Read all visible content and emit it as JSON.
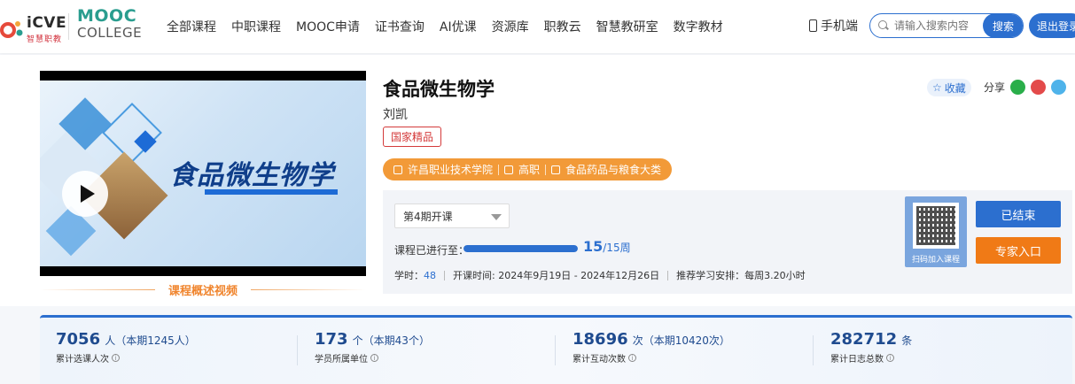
{
  "header": {
    "logo_icve": "iCVE",
    "logo_icve_sub": "智慧职教",
    "logo_mooc": "MOOC",
    "logo_mooc_sub": "COLLEGE",
    "nav": [
      "全部课程",
      "中职课程",
      "MOOC申请",
      "证书查询",
      "AI优课",
      "资源库",
      "职教云",
      "智慧教研室",
      "数字教材"
    ],
    "mobile_label": "手机端",
    "search_placeholder": "请输入搜索内容",
    "search_button": "搜索",
    "logout_button": "退出登录"
  },
  "course": {
    "title": "食品微生物学",
    "teacher": "刘凯",
    "badge": "国家精品",
    "video_title": "食品微生物学",
    "video_label": "课程概述视频",
    "tags": [
      "许昌职业技术学院",
      "高职",
      "食品药品与粮食大类"
    ],
    "favorite_label": "收藏",
    "share_label": "分享",
    "term_select": "第4期开课",
    "progress_label": "课程已进行至：",
    "progress_current": "15",
    "progress_total": "/15周",
    "progress_fraction": 1.0,
    "hours_label": "学时：",
    "hours_value": "48",
    "schedule_text": "开课时间: 2024年9月19日 - 2024年12月26日",
    "recommend_text": "推荐学习安排：每周3.20小时",
    "qr_caption": "扫码加入课程",
    "ended_button": "已结束",
    "expert_button": "专家入口"
  },
  "stats": [
    {
      "num": "7056",
      "unit": "人（本期1245人）",
      "label": "累计选课人次"
    },
    {
      "num": "173",
      "unit": "个（本期43个）",
      "label": "学员所属单位"
    },
    {
      "num": "18696",
      "unit": "次（本期10420次）",
      "label": "累计互动次数"
    },
    {
      "num": "282712",
      "unit": "条",
      "label": "累计日志总数"
    }
  ],
  "colors": {
    "brand_blue": "#2c6fcf",
    "orange": "#f29a38",
    "expert_orange": "#f07a16",
    "badge_red": "#d43a3a"
  }
}
